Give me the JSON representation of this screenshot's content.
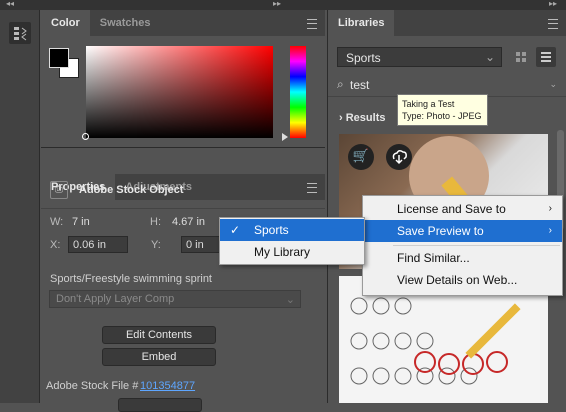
{
  "topbar": {
    "left_collapse": "◂◂",
    "right_collapse": "▸▸"
  },
  "color_panel": {
    "tabs": [
      {
        "label": "Color"
      },
      {
        "label": "Swatches"
      }
    ]
  },
  "properties_panel": {
    "tabs": [
      {
        "label": "Properties"
      },
      {
        "label": "Adjustments"
      }
    ],
    "object_title": "Adobe Stock Object",
    "w_label": "W:",
    "w_value": "7 in",
    "h_label": "H:",
    "h_value": "4.67 in",
    "x_label": "X:",
    "x_value": "0.06 in",
    "y_label": "Y:",
    "y_value": "0 in",
    "layer_name": "Sports/Freestyle swimming sprint",
    "layer_comp_placeholder": "Don't Apply Layer Comp",
    "edit_contents_label": "Edit Contents",
    "embed_label": "Embed",
    "stock_file_label": "Adobe Stock File #",
    "stock_file_link": "101354877"
  },
  "libraries_panel": {
    "tab": "Libraries",
    "library_selected": "Sports",
    "search_value": "test",
    "results_label": "Results"
  },
  "tooltip": {
    "line1": "Taking a Test",
    "line2": "Type: Photo - JPEG"
  },
  "context_menu": {
    "items": [
      {
        "label": "License and Save to",
        "arrow": "›"
      },
      {
        "label": "Save Preview to",
        "arrow": "›"
      },
      {
        "label": "Find Similar..."
      },
      {
        "label": "View Details on Web..."
      }
    ]
  },
  "submenu": {
    "items": [
      {
        "label": "Sports",
        "check": "✓"
      },
      {
        "label": "My Library"
      }
    ]
  },
  "colors": {
    "accent": "#1f6fd0",
    "tooltip_bg": "#ffffe1",
    "link": "#5ea6ff"
  }
}
